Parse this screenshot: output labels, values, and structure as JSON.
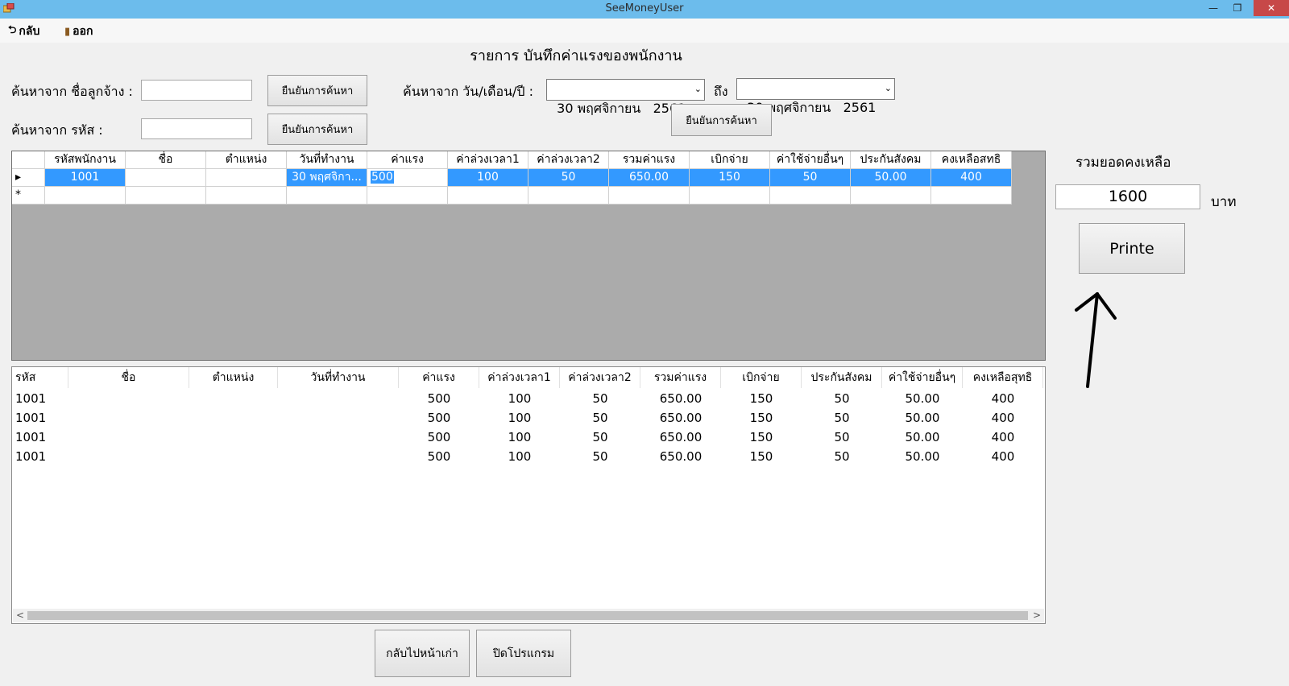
{
  "window": {
    "title": "SeeMoneyUser",
    "minimize": "—",
    "maximize": "❐",
    "close": "✕"
  },
  "menu": [
    {
      "label": "กลับ",
      "icon": "back-icon"
    },
    {
      "label": "ออก",
      "icon": "exit-door-icon"
    }
  ],
  "page_title": "รายการ บันทึกค่าแรงของพนักงาน",
  "search": {
    "name_label": "ค้นหาจาก ชื่อลูกจ้าง :",
    "name_value": "",
    "id_label": "ค้นหาจาก รหัส :",
    "id_value": "",
    "confirm_label": "ยืนยันการค้นหา",
    "date_label": "ค้นหาจาก วัน/เดือน/ปี :",
    "date_from": "30 พฤศจิกายน   2561",
    "to_label": "ถึง",
    "date_to": "30 พฤศจิกายน   2561",
    "date_confirm_label": "ยืนยันการค้นหา"
  },
  "grid_top": {
    "columns": [
      "รหัสพนักงาน",
      "ชื่อ",
      "ตำแหน่ง",
      "วันที่ทำงาน",
      "ค่าแรง",
      "ค่าล่วงเวลา1",
      "ค่าล่วงเวลา2",
      "รวมค่าแรง",
      "เบิกจ่าย",
      "ค่าใช้จ่ายอื่นๆ",
      "ประกันสังคม",
      "คงเหลือสทธิ"
    ],
    "row_marker": "▸",
    "new_marker": "*",
    "rows": [
      [
        "1001",
        "",
        "",
        "30 พฤศจิกา...",
        "500",
        "100",
        "50",
        "650.00",
        "150",
        "50",
        "50.00",
        "400"
      ]
    ]
  },
  "grid_bottom": {
    "columns": [
      "รหัส",
      "ชื่อ",
      "ตำแหน่ง",
      "วันที่ทำงาน",
      "ค่าแรง",
      "ค่าล่วงเวลา1",
      "ค่าล่วงเวลา2",
      "รวมค่าแรง",
      "เบิกจ่าย",
      "ประกันสังคม",
      "ค่าใช้จ่ายอื่นๆ",
      "คงเหลือสุทธิ"
    ],
    "rows": [
      [
        "1001",
        "",
        "",
        "",
        "500",
        "100",
        "50",
        "650.00",
        "150",
        "50",
        "50.00",
        "400"
      ],
      [
        "1001",
        "",
        "",
        "",
        "500",
        "100",
        "50",
        "650.00",
        "150",
        "50",
        "50.00",
        "400"
      ],
      [
        "1001",
        "",
        "",
        "",
        "500",
        "100",
        "50",
        "650.00",
        "150",
        "50",
        "50.00",
        "400"
      ],
      [
        "1001",
        "",
        "",
        "",
        "500",
        "100",
        "50",
        "650.00",
        "150",
        "50",
        "50.00",
        "400"
      ]
    ],
    "scroll_left": "<",
    "scroll_right": ">"
  },
  "summary": {
    "total_label": "รวมยอดคงเหลือ",
    "total_value": "1600",
    "unit": "บาท",
    "print_label": "Printe"
  },
  "footer": {
    "back_label": "กลับไปหน้าเก่า",
    "close_label": "ปิดโปรแกรม"
  }
}
